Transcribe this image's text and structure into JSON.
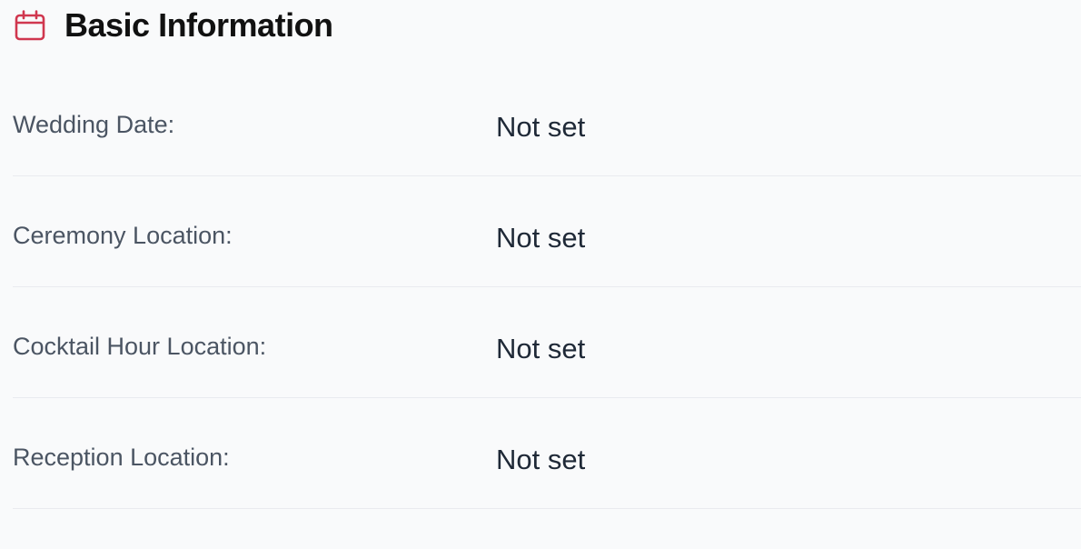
{
  "section": {
    "title": "Basic Information",
    "icon": "calendar-icon",
    "accent_color": "#d0374f"
  },
  "fields": [
    {
      "label": "Wedding Date:",
      "value": "Not set"
    },
    {
      "label": "Ceremony Location:",
      "value": "Not set"
    },
    {
      "label": "Cocktail Hour Location:",
      "value": "Not set"
    },
    {
      "label": "Reception Location:",
      "value": "Not set"
    }
  ]
}
